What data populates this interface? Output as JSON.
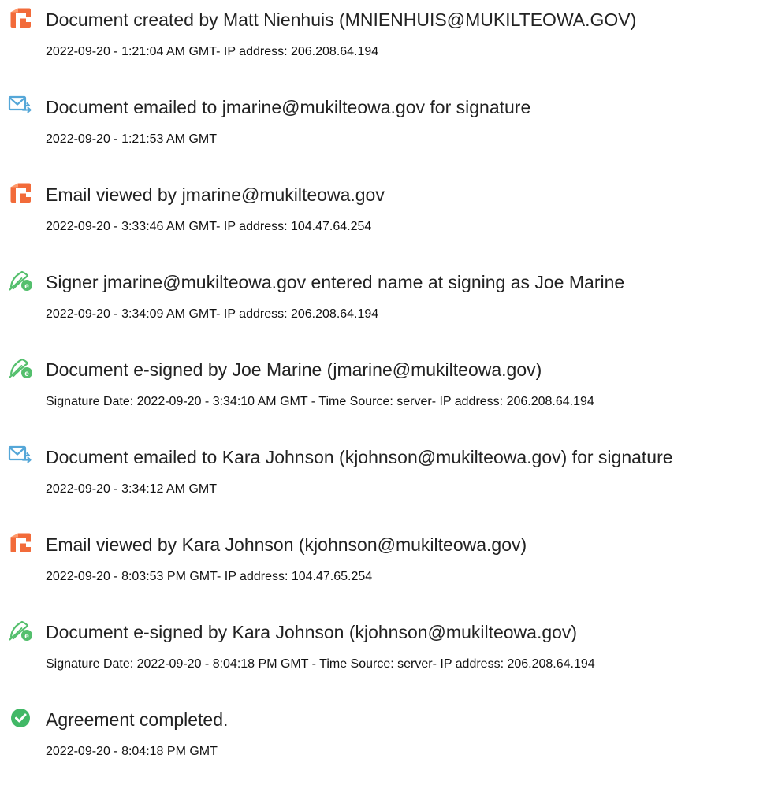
{
  "colors": {
    "document_icon": "#f26b3a",
    "email_icon": "#55a7d8",
    "sign_icon": "#54bf6d",
    "completed_icon": "#41b866",
    "text": "#222222"
  },
  "events": [
    {
      "icon": "document-icon",
      "title": "Document created by Matt Nienhuis (MNIENHUIS@MUKILTEOWA.GOV)",
      "detail": "2022-09-20 - 1:21:04 AM GMT- IP address: 206.208.64.194"
    },
    {
      "icon": "email-sent-icon",
      "title": "Document emailed to jmarine@mukilteowa.gov for signature",
      "detail": "2022-09-20 - 1:21:53 AM GMT"
    },
    {
      "icon": "document-icon",
      "title": "Email viewed by jmarine@mukilteowa.gov",
      "detail": "2022-09-20 - 3:33:46 AM GMT- IP address: 104.47.64.254"
    },
    {
      "icon": "e-sign-icon",
      "title": "Signer jmarine@mukilteowa.gov entered name at signing as Joe Marine",
      "detail": "2022-09-20 - 3:34:09 AM GMT- IP address: 206.208.64.194"
    },
    {
      "icon": "e-sign-icon",
      "title": "Document e-signed by Joe Marine (jmarine@mukilteowa.gov)",
      "detail": "Signature Date: 2022-09-20 - 3:34:10 AM GMT - Time Source: server- IP address: 206.208.64.194"
    },
    {
      "icon": "email-sent-icon",
      "title": "Document emailed to Kara Johnson (kjohnson@mukilteowa.gov) for signature",
      "detail": "2022-09-20 - 3:34:12 AM GMT"
    },
    {
      "icon": "document-icon",
      "title": "Email viewed by Kara Johnson (kjohnson@mukilteowa.gov)",
      "detail": "2022-09-20 - 8:03:53 PM GMT- IP address: 104.47.65.254"
    },
    {
      "icon": "e-sign-icon",
      "title": "Document e-signed by Kara Johnson (kjohnson@mukilteowa.gov)",
      "detail": "Signature Date: 2022-09-20 - 8:04:18 PM GMT - Time Source: server- IP address: 206.208.64.194"
    },
    {
      "icon": "check-circle-icon",
      "title": "Agreement completed.",
      "detail": "2022-09-20 - 8:04:18 PM GMT"
    }
  ]
}
